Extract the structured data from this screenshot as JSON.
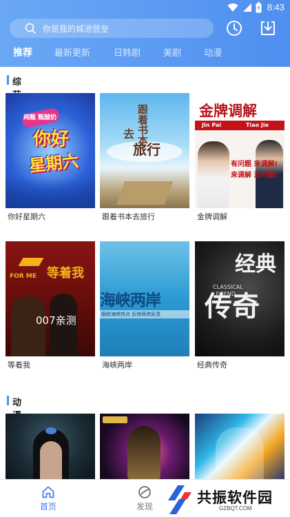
{
  "status": {
    "time": "8:43"
  },
  "search": {
    "placeholder": "你是我的城池营垒"
  },
  "tabs": [
    {
      "label": "推荐",
      "active": true
    },
    {
      "label": "最新更新",
      "active": false
    },
    {
      "label": "日韩剧",
      "active": false
    },
    {
      "label": "美剧",
      "active": false
    },
    {
      "label": "动漫",
      "active": false
    }
  ],
  "sections": [
    {
      "title": "综艺",
      "items": [
        {
          "caption": "你好星期六",
          "poster_text": [
            "你好",
            "星期六"
          ],
          "poster_badge": "纯甄 甄酸奶"
        },
        {
          "caption": "跟着书本去旅行",
          "poster_text": [
            "跟着书本",
            "去",
            "旅行"
          ]
        },
        {
          "caption": "金牌调解",
          "poster_text": [
            "金牌调解",
            "Jin Pai",
            "Tiao Jie",
            "有问题 来调解!",
            "来调解 没问题!"
          ]
        },
        {
          "caption": "等着我",
          "poster_text": [
            "等着我",
            "FOR ME",
            "007亲测"
          ]
        },
        {
          "caption": "海峡两岸",
          "poster_text": [
            "海峡两岸",
            "跟踪海峡热点  反映两岸民意"
          ]
        },
        {
          "caption": "经典传奇",
          "poster_text": [
            "经典",
            "传奇",
            "CLASSICAL",
            "LEGEND"
          ]
        }
      ]
    },
    {
      "title": "动漫",
      "items": [
        {},
        {},
        {}
      ]
    }
  ],
  "bottom_nav": [
    {
      "label": "首页",
      "icon": "home-icon",
      "active": true
    },
    {
      "label": "发现",
      "icon": "discover-icon",
      "active": false
    }
  ],
  "watermark": {
    "text": "共振软件园",
    "url": "GZBQT.COM"
  },
  "colors": {
    "accent": "#4e8ff0",
    "header_start": "#6aa8f5",
    "header_end": "#4e8ff0"
  }
}
